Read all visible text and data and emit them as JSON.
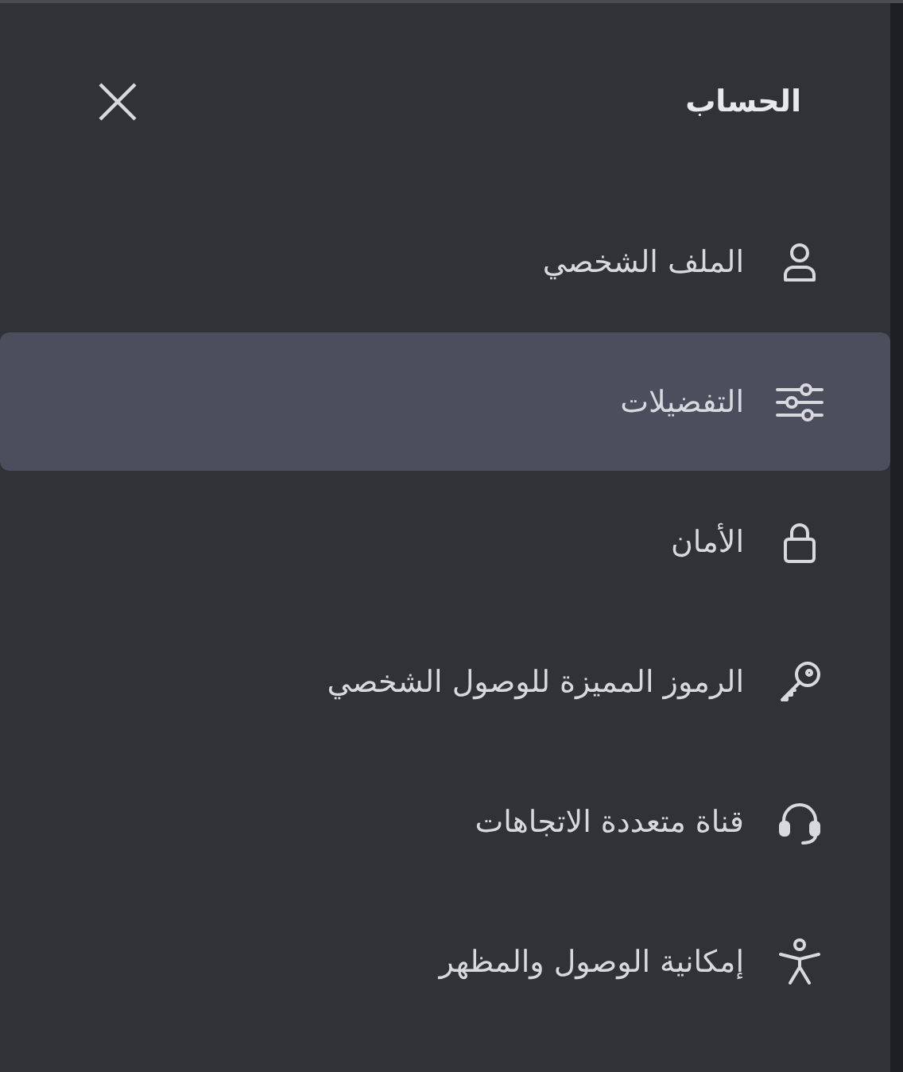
{
  "panel": {
    "title": "الحساب"
  },
  "items": [
    {
      "label": "الملف الشخصي",
      "kind": "person",
      "selected": false
    },
    {
      "label": "التفضيلات",
      "kind": "sliders",
      "selected": true
    },
    {
      "label": "الأمان",
      "kind": "lock",
      "selected": false
    },
    {
      "label": "الرموز المميزة للوصول الشخصي",
      "kind": "key",
      "selected": false
    },
    {
      "label": "قناة متعددة الاتجاهات",
      "kind": "headset",
      "selected": false
    },
    {
      "label": "إمكانية الوصول والمظهر",
      "kind": "accessibility",
      "selected": false
    }
  ]
}
